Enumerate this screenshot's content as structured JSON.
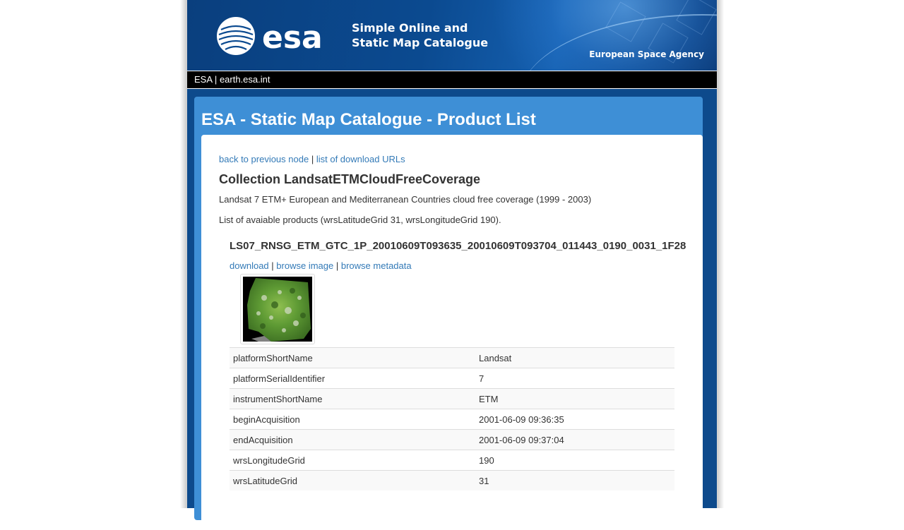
{
  "banner": {
    "logo_text": "esa",
    "title_line1": "Simple Online and",
    "title_line2": "Static Map Catalogue",
    "agency": "European Space Agency"
  },
  "topnav": {
    "esa_link": "ESA",
    "separator": "|",
    "earth_link": "earth.esa.int"
  },
  "panel": {
    "title": "ESA - Static Map Catalogue - Product List"
  },
  "nav": {
    "back_link": "back to previous node",
    "separator": "|",
    "download_urls_link": "list of download URLs"
  },
  "collection": {
    "title": "Collection LandsatETMCloudFreeCoverage",
    "description": "Landsat 7 ETM+ European and Mediterranean Countries cloud free coverage (1999 - 2003)",
    "available": "List of avaiable products (wrsLatitudeGrid 31, wrsLongitudeGrid 190)."
  },
  "product": {
    "id": "LS07_RNSG_ETM_GTC_1P_20010609T093635_20010609T093704_011443_0190_0031_1F28",
    "links": {
      "download": "download",
      "browse_image": "browse image",
      "browse_metadata": "browse metadata",
      "separator": "|"
    },
    "metadata": [
      {
        "key": "platformShortName",
        "value": "Landsat"
      },
      {
        "key": "platformSerialIdentifier",
        "value": "7"
      },
      {
        "key": "instrumentShortName",
        "value": "ETM"
      },
      {
        "key": "beginAcquisition",
        "value": "2001-06-09 09:36:35"
      },
      {
        "key": "endAcquisition",
        "value": "2001-06-09 09:37:04"
      },
      {
        "key": "wrsLongitudeGrid",
        "value": "190"
      },
      {
        "key": "wrsLatitudeGrid",
        "value": "31"
      }
    ]
  },
  "colors": {
    "banner_blue": "#0b4a90",
    "panel_blue": "#3e8fd6",
    "link_blue": "#337ab7",
    "nav_black": "#000000"
  }
}
